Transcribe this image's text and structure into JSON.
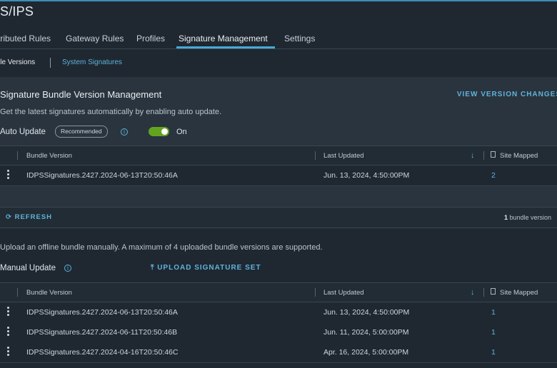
{
  "page": {
    "title": "S/IPS"
  },
  "tabs": [
    "tributed Rules",
    "Gateway Rules",
    "Profiles",
    "Signature Management",
    "Settings"
  ],
  "subnav": {
    "active": "lle Versions",
    "link": "System Signatures"
  },
  "auto_section": {
    "title": "Signature Bundle Version Management",
    "view_changes": "VIEW VERSION CHANGES",
    "description": "Get the latest signatures automatically by enabling auto update.",
    "label": "Auto Update",
    "badge": "Recommended",
    "toggle_state": "On",
    "toggle_on": true
  },
  "grid_headers": {
    "bundle_version": "Bundle Version",
    "last_updated": "Last Updated",
    "site_mapped": "Site Mapped"
  },
  "auto_rows": [
    {
      "bundle": "IDPSSignatures.2427.2024-06-13T20:50:46A",
      "updated": "Jun. 13, 2024, 4:50:00PM",
      "sites": "2"
    }
  ],
  "refresh": {
    "label": "REFRESH",
    "count": "1",
    "count_suffix": " bundle version"
  },
  "manual_section": {
    "description": "Upload an offline bundle manually. A maximum of 4 uploaded bundle versions are supported.",
    "label": "Manual Update",
    "upload": "UPLOAD SIGNATURE SET"
  },
  "manual_rows": [
    {
      "bundle": "IDPSSignatures.2427.2024-06-13T20:50:46A",
      "updated": "Jun. 13, 2024, 4:50:00PM",
      "sites": "1"
    },
    {
      "bundle": "IDPSSignatures.2427.2024-06-11T20:50:46B",
      "updated": "Jun. 11, 2024, 5:00:00PM",
      "sites": "1"
    },
    {
      "bundle": "IDPSSignatures.2427.2024-04-16T20:50:46C",
      "updated": "Apr. 16, 2024, 5:00:00PM",
      "sites": "1"
    }
  ],
  "colors": {
    "accent": "#5fb3dc",
    "toggle_on": "#62a420",
    "background": "#1f2831",
    "panel": "#2a343e"
  },
  "icons": [
    "info-icon",
    "sort-down-icon",
    "document-icon",
    "kebab-menu-icon",
    "refresh-icon",
    "upload-icon"
  ]
}
